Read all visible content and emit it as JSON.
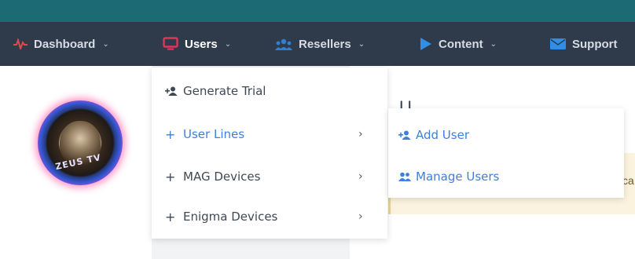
{
  "navbar": {
    "items": [
      {
        "label": "Dashboard",
        "icon": "pulse-icon",
        "icon_color": "#e0484b",
        "has_chevron": true
      },
      {
        "label": "Users",
        "icon": "monitor-icon",
        "icon_color": "#e2335d",
        "has_chevron": true,
        "active": true
      },
      {
        "label": "Resellers",
        "icon": "users-group-icon",
        "icon_color": "#2f7fd4",
        "has_chevron": true
      },
      {
        "label": "Content",
        "icon": "play-icon",
        "icon_color": "#2f8fe8",
        "has_chevron": true
      },
      {
        "label": "Support",
        "icon": "envelope-icon",
        "icon_color": "#2f8fe8",
        "has_chevron": false
      }
    ],
    "chevron_glyph": "⌄"
  },
  "logo": {
    "text": "ZEUS TV"
  },
  "content": {
    "heading_fragment": "U",
    "warning_fragment": "ca"
  },
  "users_menu": {
    "items": [
      {
        "label": "Generate Trial",
        "prefix": "user-plus-icon"
      },
      {
        "label": "User Lines",
        "prefix": "+",
        "active": true,
        "has_submenu": true
      },
      {
        "label": "MAG Devices",
        "prefix": "+",
        "has_submenu": true
      },
      {
        "label": "Enigma Devices",
        "prefix": "+",
        "has_submenu": true
      }
    ],
    "submenu_glyph": "›"
  },
  "user_lines_submenu": {
    "items": [
      {
        "label": "Add User",
        "icon": "user-plus-icon"
      },
      {
        "label": "Manage Users",
        "icon": "users-group-icon"
      }
    ]
  },
  "colors": {
    "topbar": "#1c6a74",
    "navbar": "#2f3b4b",
    "accent": "#3d7fe0",
    "warning_bg": "#fbf3de"
  }
}
